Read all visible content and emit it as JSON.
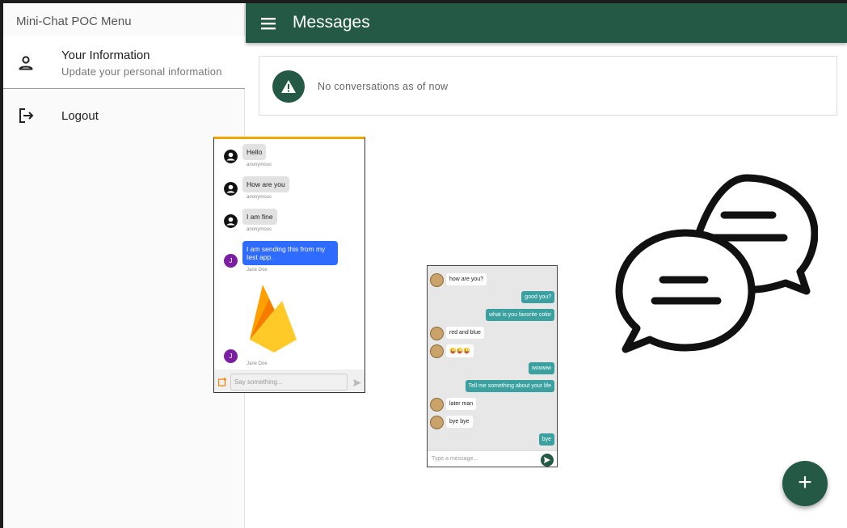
{
  "drawer": {
    "title": "Mini-Chat POC Menu",
    "items": [
      {
        "icon": "person-icon",
        "label": "Your Information",
        "sublabel": "Update your personal information"
      },
      {
        "icon": "logout-icon",
        "label": "Logout"
      }
    ]
  },
  "appbar": {
    "title": "Messages",
    "menu_icon": "hamburger-icon"
  },
  "empty_card": {
    "icon": "warning-icon",
    "text": "No conversations as of now"
  },
  "chat_preview_1": {
    "messages": [
      {
        "text": "Hello",
        "name": "anonymous"
      },
      {
        "text": "How are you",
        "name": "anonymous"
      },
      {
        "text": "I am fine",
        "name": "anonymous"
      },
      {
        "text": "I am sending this from my test app.",
        "name": "Jane Doe",
        "avatar_letter": "J"
      },
      {
        "name": "Jane Doe",
        "avatar_letter": "J"
      }
    ],
    "input_placeholder": "Say something..."
  },
  "chat_preview_2": {
    "messages": [
      {
        "side": "in",
        "text": "how are you?"
      },
      {
        "side": "out",
        "text": "good you?"
      },
      {
        "side": "out",
        "text": "what is you favorite color"
      },
      {
        "side": "in",
        "text": "red and blue"
      },
      {
        "side": "in",
        "text": "😜😜😜"
      },
      {
        "side": "out",
        "text": "wowww"
      },
      {
        "side": "out",
        "text": "Tell me something about your life"
      },
      {
        "side": "in",
        "text": "later man"
      },
      {
        "side": "in",
        "text": "bye bye"
      },
      {
        "side": "out",
        "text": "bye"
      }
    ],
    "input_placeholder": "Type a message..."
  },
  "fab": {
    "label": "+"
  },
  "colors": {
    "primary": "#245a45",
    "bubble_blue": "#2f6bff",
    "bubble_teal": "#3aa0a0",
    "firebase_accent": "#f2a400"
  }
}
